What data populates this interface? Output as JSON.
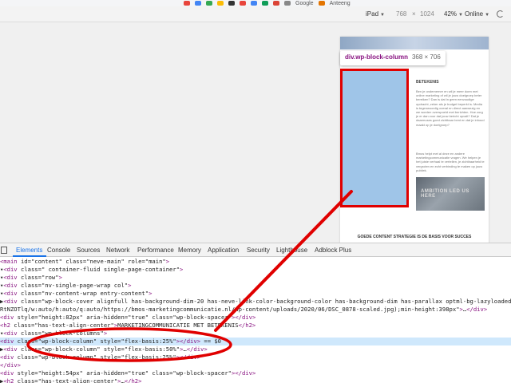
{
  "device_toolbar": {
    "device": "iPad",
    "width": "768",
    "times": "×",
    "height": "1024",
    "zoom": "42%",
    "network": "Online",
    "bookmark_1": "Google",
    "bookmark_2": "Anteeng"
  },
  "device_page": {
    "title": "BETEKENIS",
    "para_1": "Ben je ondernemer en wil je meer doen met online marketing of wil je jouw doelgroep beter bereiken? Dan is dat in geen eenvoudige opdracht, zeker als je budget beperkt is. Media is tegenwoordig overal en direct aanwezig en we worden overspoeld met berichten. Hoe zorg je er dan voor dat jouw bericht opvalt? Dat je daarmuses goed zichtbaar bent en dat je inhoud maakt op je doelgroep?",
    "para_2": "Bmos helpt met al deze en andere marketingcommunicatie vragen. We helpen je het juiste verhaal te vertellen, je zichtbaarheid te vergroten en echt verbinding te maken op jouw publiek.",
    "photo_text": "AMBITION LED US HERE",
    "section_heading": "GOEDE CONTENT STRATEGIE IS DE BASIS VOOR SUCCES",
    "footer_badge": "bmos",
    "highlight_color": "#9fc5e8"
  },
  "tooltip": {
    "name": "div.wp-block-column",
    "size": "368 × 706"
  },
  "devtools": {
    "tabs": [
      "Elements",
      "Console",
      "Sources",
      "Network",
      "Performance",
      "Memory",
      "Application",
      "Security",
      "Lighthouse",
      "Adblock Plus"
    ],
    "active_tab": "Elements",
    "accent": "#1a73e8"
  },
  "tree": [
    "<main id=\"content\" class=\"neve-main\" role=\"main\">",
    "▾<div class=\"  container-fluid single-page-container\">",
    "  ▾<div class=\"row\">",
    "    ▾<div class=\"nv-single-page-wrap col\">",
    "      ▾<div class=\"nv-content-wrap entry-content\">",
    "        ▶<div class=\"wp-block-cover alignfull has-background-dim-20 has-neve-link-color-background-color has-background-dim has-parallax optml-bg-lazyloaded\" style=\"background-image:url(https://",
    "        RtNZOTlq/w:auto/h:auto/q:auto/https://bmos-marketingcommunicatie.nl/wp-content/uploads/2020/06/DSC_0878-scaled.jpg);min-height:398px\">…</div>",
    "         <div style=\"height:82px\" aria-hidden=\"true\" class=\"wp-block-spacer\"></div>",
    "         <h2 class=\"has-text-align-center\">MARKETINGCOMMUNICATIE MET BETEKENIS</h2>",
    "        ▾<div class=\"wp-block-columns\">",
    "           <div class=\"wp-block-column\" style=\"flex-basis:25%\"></div> == $0",
    "          ▶<div class=\"wp-block-column\" style=\"flex-basis:50%\">…</div>",
    "           <div class=\"wp-block-column\" style=\"flex-basis:25%\"></div>",
    "         </div>",
    "         <div style=\"height:54px\" aria-hidden=\"true\" class=\"wp-block-spacer\"></div>",
    "        ▶<h2 class=\"has-text-align-center\">…</h2>",
    "         <div style=\"height:54px\" aria-hidden=\"true\" class=\"wp-block-spacer\"></div>"
  ],
  "selected_line": 10,
  "annotation_color": "#e00000"
}
